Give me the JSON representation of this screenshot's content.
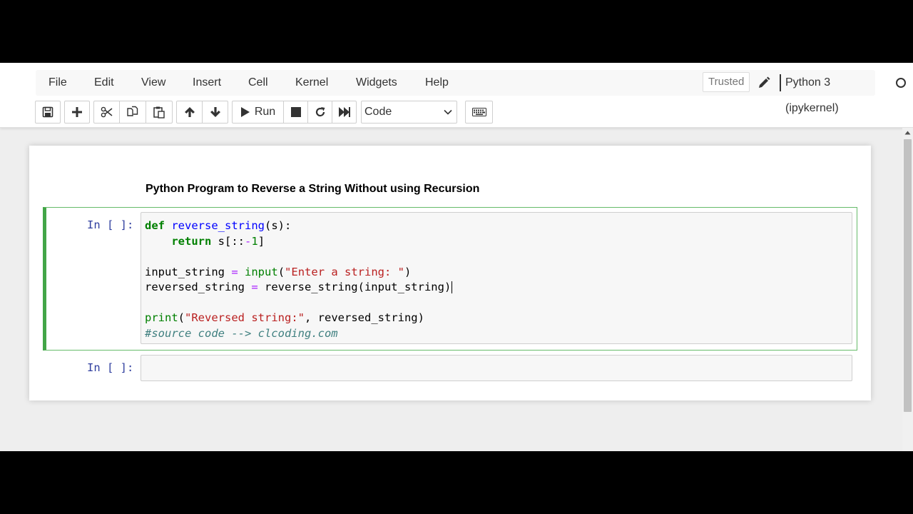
{
  "menu": {
    "items": [
      "File",
      "Edit",
      "View",
      "Insert",
      "Cell",
      "Kernel",
      "Widgets",
      "Help"
    ]
  },
  "status": {
    "trusted": "Trusted",
    "kernel": "Python 3 (ipykernel)"
  },
  "toolbar": {
    "run_label": "Run",
    "cell_type": "Code",
    "icons": [
      "save-icon",
      "plus-icon",
      "scissors-icon",
      "copy-icon",
      "paste-icon",
      "arrow-up-icon",
      "arrow-down-icon",
      "play-icon",
      "stop-icon",
      "restart-icon",
      "fast-forward-icon",
      "keyboard-icon"
    ]
  },
  "notebook": {
    "heading": "Python Program to Reverse a String Without using Recursion",
    "cells": [
      {
        "prompt": "In [ ]:",
        "source_lines": [
          "def reverse_string(s):",
          "    return s[::-1]",
          "",
          "input_string = input(\"Enter a string: \")",
          "reversed_string = reverse_string(input_string)",
          "",
          "print(\"Reversed string:\", reversed_string)",
          "#source code --> clcoding.com"
        ]
      },
      {
        "prompt": "In [ ]:",
        "source_lines": []
      }
    ]
  },
  "colors": {
    "selected_cell_border": "#42a547",
    "prompt": "#303f9f",
    "keyword": "#008000",
    "function_name": "#0000ff",
    "string": "#ba2121",
    "comment": "#408080"
  }
}
